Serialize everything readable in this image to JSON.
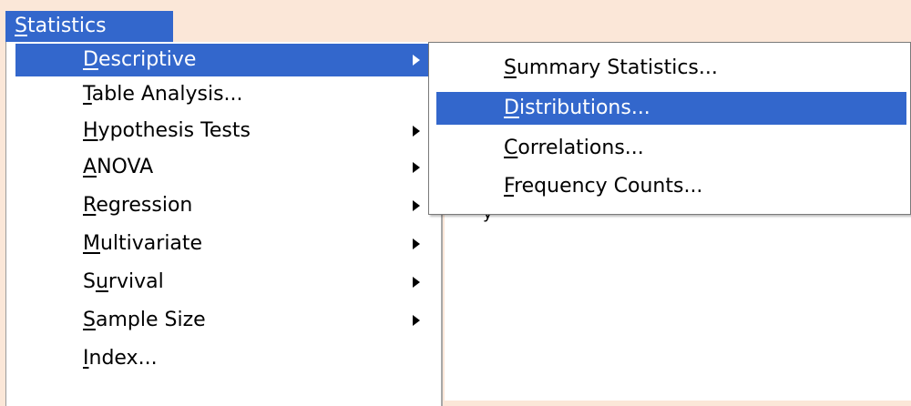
{
  "menubar": {
    "title_prefix": "S",
    "title_rest": "tatistics"
  },
  "statistics_menu": {
    "items": [
      {
        "key": "D",
        "rest": "escriptive",
        "has_submenu": true,
        "active": true
      },
      {
        "key": "T",
        "rest": "able Analysis...",
        "has_submenu": false
      },
      {
        "key": "H",
        "rest": "ypothesis Tests",
        "has_submenu": true
      },
      {
        "key": "A",
        "rest": "NOVA",
        "has_submenu": true
      },
      {
        "key": "R",
        "rest": "egression",
        "has_submenu": true
      },
      {
        "key": "M",
        "rest": "ultivariate",
        "has_submenu": true
      },
      {
        "pre": "S",
        "key": "u",
        "rest": "rvival",
        "has_submenu": true
      },
      {
        "key": "S",
        "rest": "ample Size",
        "has_submenu": true
      },
      {
        "key": "I",
        "rest": "ndex...",
        "has_submenu": false
      }
    ]
  },
  "descriptive_submenu": {
    "items": [
      {
        "key": "S",
        "rest": "ummary Statistics..."
      },
      {
        "key": "D",
        "rest": "istributions...",
        "active": true
      },
      {
        "key": "C",
        "rest": "orrelations..."
      },
      {
        "key": "F",
        "rest": "requency Counts..."
      }
    ]
  },
  "background": {
    "fragment": "y"
  },
  "colors": {
    "highlight": "#3367cc",
    "page_background": "#fbe7d8"
  },
  "icons": {
    "submenu_arrow": "triangle-right-icon"
  }
}
